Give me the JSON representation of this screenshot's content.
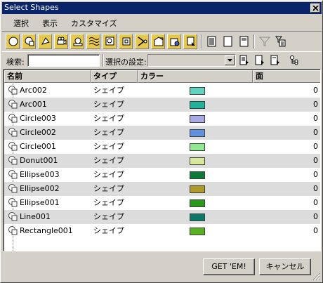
{
  "window": {
    "title": "Select Shapes"
  },
  "menu": [
    "選択",
    "表示",
    "カスタマイズ"
  ],
  "toolbar": {
    "filter_icons": [
      "circle-icon",
      "arc-icon",
      "donut-icon",
      "camera-icon",
      "ellipse-icon",
      "helix-icon",
      "ngon-icon",
      "rectangle-icon",
      "line-icon",
      "section-icon",
      "star-icon",
      "text-icon"
    ],
    "view_icons": [
      "list-all-icon",
      "list-none-icon",
      "list-invert-icon"
    ],
    "option_icons": [
      "filter-icon",
      "filter-options-icon"
    ]
  },
  "search": {
    "label": "検索:",
    "value": "",
    "set_label": "選択の設定:",
    "set_value": ""
  },
  "columns": [
    "名前",
    "タイプ",
    "カラー",
    "面"
  ],
  "rows": [
    {
      "name": "Arc002",
      "type": "シェイプ",
      "color": "#5fd3bf",
      "faces": "0"
    },
    {
      "name": "Arc001",
      "type": "シェイプ",
      "color": "#22b49a",
      "faces": "0"
    },
    {
      "name": "Circle003",
      "type": "シェイプ",
      "color": "#a8a8e6",
      "faces": "0"
    },
    {
      "name": "Circle002",
      "type": "シェイプ",
      "color": "#6090e0",
      "faces": "0"
    },
    {
      "name": "Circle001",
      "type": "シェイプ",
      "color": "#90e890",
      "faces": "0"
    },
    {
      "name": "Donut001",
      "type": "シェイプ",
      "color": "#d8e89a",
      "faces": "0"
    },
    {
      "name": "Ellipse003",
      "type": "シェイプ",
      "color": "#0d7a3a",
      "faces": "0"
    },
    {
      "name": "Ellipse002",
      "type": "シェイプ",
      "color": "#ae9a26",
      "faces": "0"
    },
    {
      "name": "Ellipse001",
      "type": "シェイプ",
      "color": "#2a9a1a",
      "faces": "0"
    },
    {
      "name": "Line001",
      "type": "シェイプ",
      "color": "#0a7a68",
      "faces": "0"
    },
    {
      "name": "Rectangle001",
      "type": "シェイプ",
      "color": "#56b020",
      "faces": "0"
    }
  ],
  "buttons": {
    "ok": "GET 'EM!",
    "cancel": "キャンセル"
  }
}
